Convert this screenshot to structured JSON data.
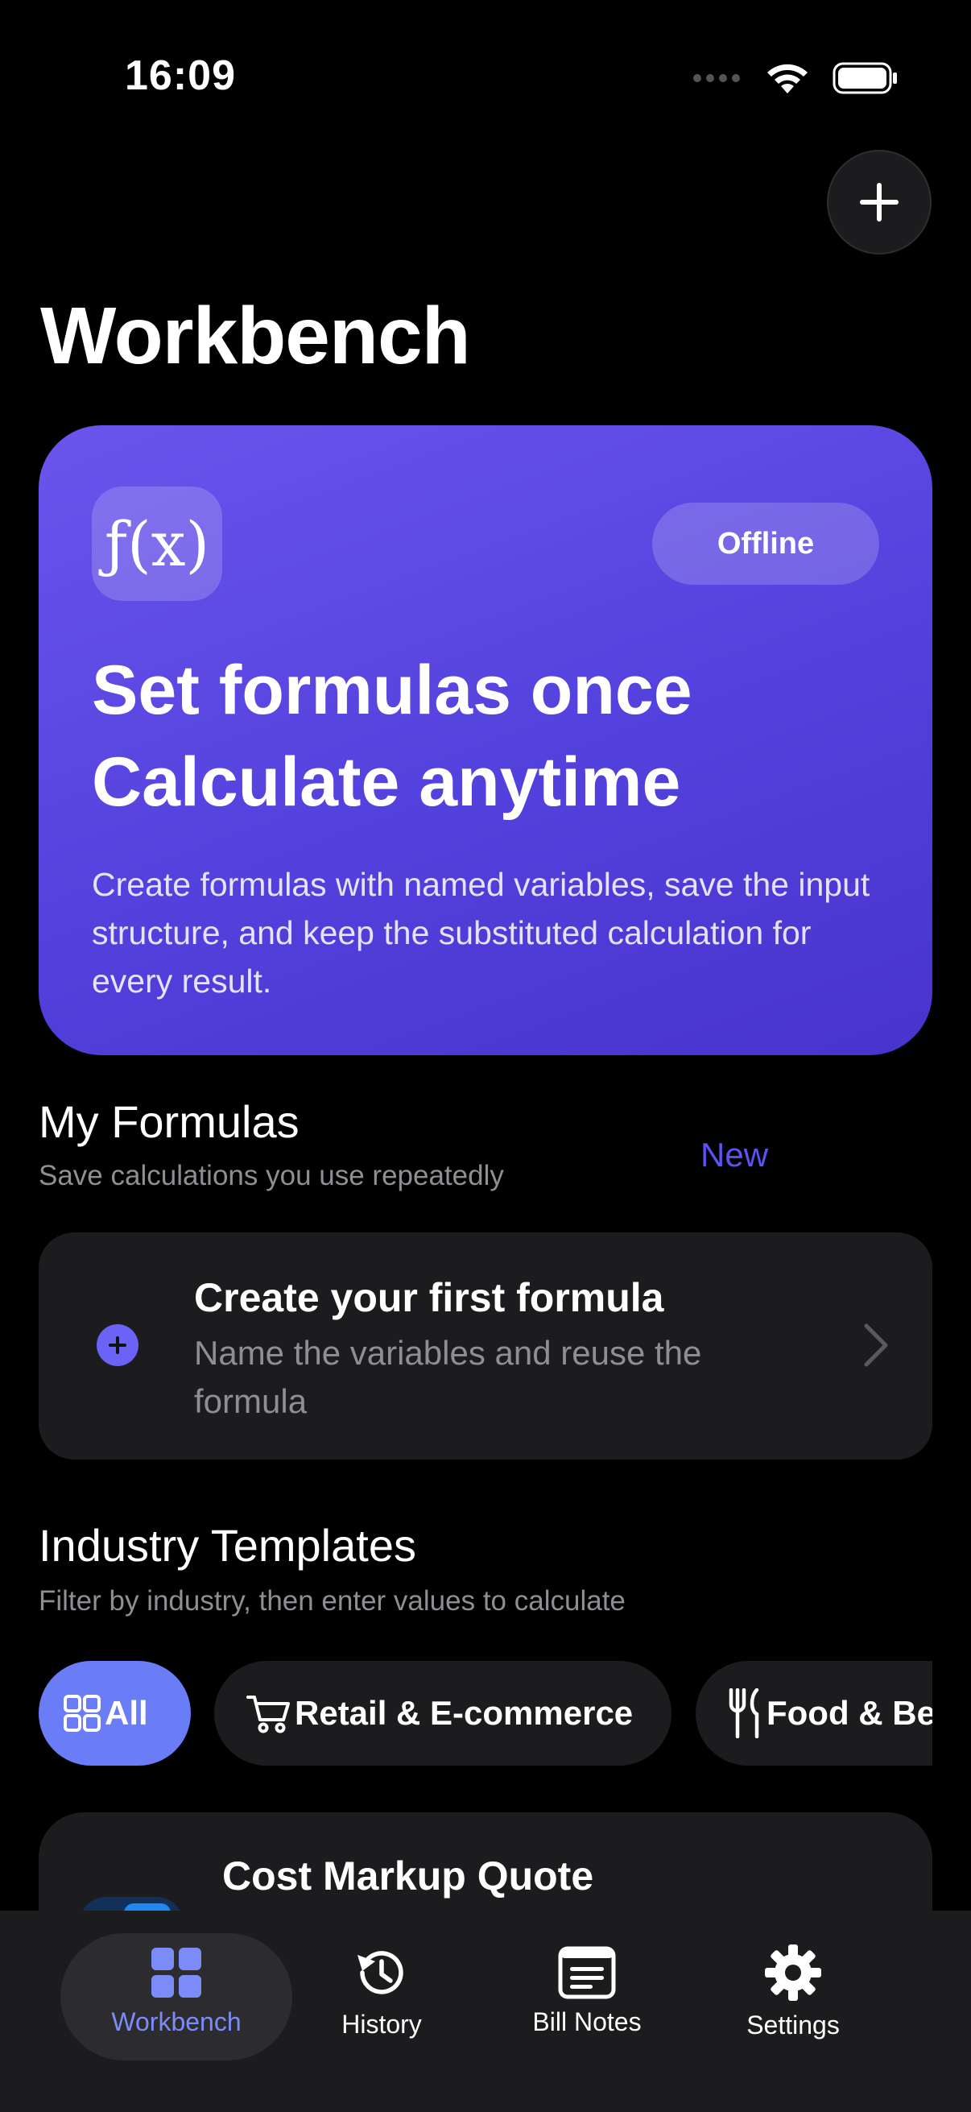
{
  "status_bar": {
    "time": "16:09"
  },
  "header": {
    "title": "Workbench"
  },
  "hero": {
    "badge": "ƒ(x)",
    "pill": "Offline",
    "title_line1": "Set formulas once",
    "title_line2": "Calculate anytime",
    "description": "Create formulas with named variables, save the input structure, and keep the substituted calculation for every result."
  },
  "my_formulas": {
    "title": "My Formulas",
    "subtitle": "Save calculations you use repeatedly",
    "new_label": "New",
    "empty_card": {
      "title": "Create your first formula",
      "description": "Name the variables and reuse the formula"
    }
  },
  "templates": {
    "title": "Industry Templates",
    "subtitle": "Filter by industry, then enter values to calculate",
    "chips": [
      {
        "label": "All",
        "icon": "grid-icon",
        "active": true
      },
      {
        "label": "Retail & E-commerce",
        "icon": "cart-icon",
        "active": false
      },
      {
        "label": "Food & Beverage",
        "icon": "fork-knife-icon",
        "active": false
      }
    ],
    "first_card": {
      "title": "Cost Markup Quote"
    }
  },
  "tabbar": {
    "items": [
      {
        "label": "Workbench",
        "icon": "grid-icon",
        "active": true
      },
      {
        "label": "History",
        "icon": "history-icon",
        "active": false
      },
      {
        "label": "Bill Notes",
        "icon": "notes-icon",
        "active": false
      },
      {
        "label": "Settings",
        "icon": "gear-icon",
        "active": false
      }
    ]
  },
  "colors": {
    "accent": "#5b52f0",
    "hero_gradient_start": "#6a55ec",
    "hero_gradient_end": "#4834cc",
    "active_chip": "#6b7cf7",
    "active_tab_label": "#7b8cf8",
    "card_bg": "#1c1c1e",
    "secondary_text": "#8e8e93"
  }
}
